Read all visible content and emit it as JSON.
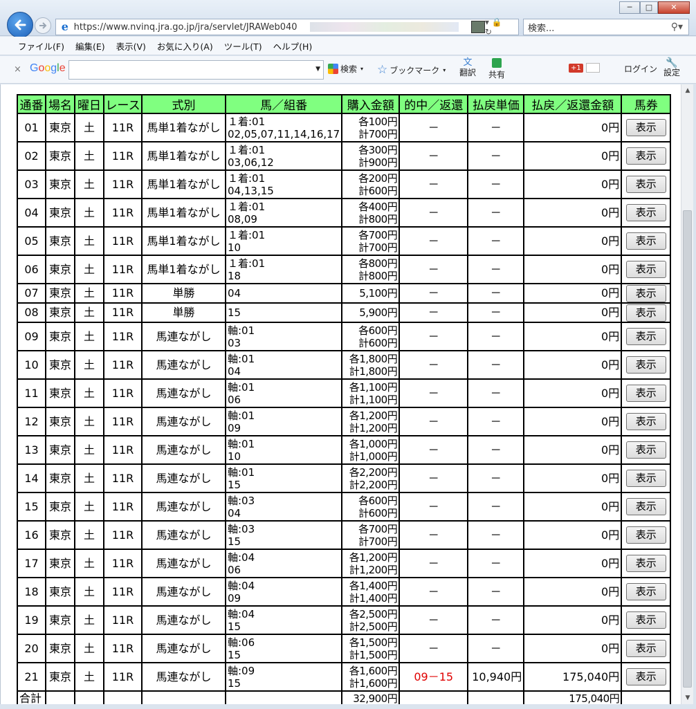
{
  "browser": {
    "url": "https://www.nvinq.jra.go.jp/jra/servlet/JRAWeb040",
    "search_placeholder": "検索...",
    "window_buttons": {
      "minimize": "─",
      "maximize": "□",
      "close": "✕"
    }
  },
  "menu": [
    "ファイル(F)",
    "編集(E)",
    "表示(V)",
    "お気に入り(A)",
    "ツール(T)",
    "ヘルプ(H)"
  ],
  "google_toolbar": {
    "close": "×",
    "logo": "Google",
    "search_label": "検索",
    "bookmark_label": "ブックマーク",
    "translate_label": "翻訳",
    "share_label": "共有",
    "plus_label": "+1",
    "login_label": "ログイン",
    "settings_label": "設定"
  },
  "colors": {
    "header_bg": "#80ff80",
    "hit_text": "#e00000",
    "brand_g_blue": "#4285f4"
  },
  "table": {
    "headers": [
      "通番",
      "場名",
      "曜日",
      "レース",
      "式別",
      "馬／組番",
      "購入金額",
      "的中／返還",
      "払戻単価",
      "払戻／返還金額",
      "馬券"
    ],
    "rows": [
      {
        "no": "01",
        "place": "東京",
        "day": "土",
        "race": "11R",
        "type": "馬単1着ながし",
        "combo1": "１着:01",
        "combo2": "02,05,07,11,14,16,17",
        "amt1": "各100円",
        "amt2": "計700円",
        "hit": "－",
        "unit": "－",
        "payout": "0円",
        "btn": "表示"
      },
      {
        "no": "02",
        "place": "東京",
        "day": "土",
        "race": "11R",
        "type": "馬単1着ながし",
        "combo1": "１着:01",
        "combo2": "03,06,12",
        "amt1": "各300円",
        "amt2": "計900円",
        "hit": "－",
        "unit": "－",
        "payout": "0円",
        "btn": "表示"
      },
      {
        "no": "03",
        "place": "東京",
        "day": "土",
        "race": "11R",
        "type": "馬単1着ながし",
        "combo1": "１着:01",
        "combo2": "04,13,15",
        "amt1": "各200円",
        "amt2": "計600円",
        "hit": "－",
        "unit": "－",
        "payout": "0円",
        "btn": "表示"
      },
      {
        "no": "04",
        "place": "東京",
        "day": "土",
        "race": "11R",
        "type": "馬単1着ながし",
        "combo1": "１着:01",
        "combo2": "08,09",
        "amt1": "各400円",
        "amt2": "計800円",
        "hit": "－",
        "unit": "－",
        "payout": "0円",
        "btn": "表示"
      },
      {
        "no": "05",
        "place": "東京",
        "day": "土",
        "race": "11R",
        "type": "馬単1着ながし",
        "combo1": "１着:01",
        "combo2": "10",
        "amt1": "各700円",
        "amt2": "計700円",
        "hit": "－",
        "unit": "－",
        "payout": "0円",
        "btn": "表示"
      },
      {
        "no": "06",
        "place": "東京",
        "day": "土",
        "race": "11R",
        "type": "馬単1着ながし",
        "combo1": "１着:01",
        "combo2": "18",
        "amt1": "各800円",
        "amt2": "計800円",
        "hit": "－",
        "unit": "－",
        "payout": "0円",
        "btn": "表示"
      },
      {
        "no": "07",
        "place": "東京",
        "day": "土",
        "race": "11R",
        "type": "単勝",
        "combo1": "04",
        "combo2": "",
        "amt1": "",
        "amt2": "5,100円",
        "hit": "－",
        "unit": "－",
        "payout": "0円",
        "btn": "表示",
        "short": true
      },
      {
        "no": "08",
        "place": "東京",
        "day": "土",
        "race": "11R",
        "type": "単勝",
        "combo1": "15",
        "combo2": "",
        "amt1": "",
        "amt2": "5,900円",
        "hit": "－",
        "unit": "－",
        "payout": "0円",
        "btn": "表示",
        "short": true
      },
      {
        "no": "09",
        "place": "東京",
        "day": "土",
        "race": "11R",
        "type": "馬連ながし",
        "combo1": "軸:01",
        "combo2": "03",
        "amt1": "各600円",
        "amt2": "計600円",
        "hit": "－",
        "unit": "－",
        "payout": "0円",
        "btn": "表示"
      },
      {
        "no": "10",
        "place": "東京",
        "day": "土",
        "race": "11R",
        "type": "馬連ながし",
        "combo1": "軸:01",
        "combo2": "04",
        "amt1": "各1,800円",
        "amt2": "計1,800円",
        "hit": "－",
        "unit": "－",
        "payout": "0円",
        "btn": "表示"
      },
      {
        "no": "11",
        "place": "東京",
        "day": "土",
        "race": "11R",
        "type": "馬連ながし",
        "combo1": "軸:01",
        "combo2": "06",
        "amt1": "各1,100円",
        "amt2": "計1,100円",
        "hit": "－",
        "unit": "－",
        "payout": "0円",
        "btn": "表示"
      },
      {
        "no": "12",
        "place": "東京",
        "day": "土",
        "race": "11R",
        "type": "馬連ながし",
        "combo1": "軸:01",
        "combo2": "09",
        "amt1": "各1,200円",
        "amt2": "計1,200円",
        "hit": "－",
        "unit": "－",
        "payout": "0円",
        "btn": "表示"
      },
      {
        "no": "13",
        "place": "東京",
        "day": "土",
        "race": "11R",
        "type": "馬連ながし",
        "combo1": "軸:01",
        "combo2": "10",
        "amt1": "各1,000円",
        "amt2": "計1,000円",
        "hit": "－",
        "unit": "－",
        "payout": "0円",
        "btn": "表示"
      },
      {
        "no": "14",
        "place": "東京",
        "day": "土",
        "race": "11R",
        "type": "馬連ながし",
        "combo1": "軸:01",
        "combo2": "15",
        "amt1": "各2,200円",
        "amt2": "計2,200円",
        "hit": "－",
        "unit": "－",
        "payout": "0円",
        "btn": "表示"
      },
      {
        "no": "15",
        "place": "東京",
        "day": "土",
        "race": "11R",
        "type": "馬連ながし",
        "combo1": "軸:03",
        "combo2": "04",
        "amt1": "各600円",
        "amt2": "計600円",
        "hit": "－",
        "unit": "－",
        "payout": "0円",
        "btn": "表示"
      },
      {
        "no": "16",
        "place": "東京",
        "day": "土",
        "race": "11R",
        "type": "馬連ながし",
        "combo1": "軸:03",
        "combo2": "15",
        "amt1": "各700円",
        "amt2": "計700円",
        "hit": "－",
        "unit": "－",
        "payout": "0円",
        "btn": "表示"
      },
      {
        "no": "17",
        "place": "東京",
        "day": "土",
        "race": "11R",
        "type": "馬連ながし",
        "combo1": "軸:04",
        "combo2": "06",
        "amt1": "各1,200円",
        "amt2": "計1,200円",
        "hit": "－",
        "unit": "－",
        "payout": "0円",
        "btn": "表示"
      },
      {
        "no": "18",
        "place": "東京",
        "day": "土",
        "race": "11R",
        "type": "馬連ながし",
        "combo1": "軸:04",
        "combo2": "09",
        "amt1": "各1,400円",
        "amt2": "計1,400円",
        "hit": "－",
        "unit": "－",
        "payout": "0円",
        "btn": "表示"
      },
      {
        "no": "19",
        "place": "東京",
        "day": "土",
        "race": "11R",
        "type": "馬連ながし",
        "combo1": "軸:04",
        "combo2": "15",
        "amt1": "各2,500円",
        "amt2": "計2,500円",
        "hit": "－",
        "unit": "－",
        "payout": "0円",
        "btn": "表示"
      },
      {
        "no": "20",
        "place": "東京",
        "day": "土",
        "race": "11R",
        "type": "馬連ながし",
        "combo1": "軸:06",
        "combo2": "15",
        "amt1": "各1,500円",
        "amt2": "計1,500円",
        "hit": "－",
        "unit": "－",
        "payout": "0円",
        "btn": "表示"
      },
      {
        "no": "21",
        "place": "東京",
        "day": "土",
        "race": "11R",
        "type": "馬連ながし",
        "combo1": "軸:09",
        "combo2": "15",
        "amt1": "各1,600円",
        "amt2": "計1,600円",
        "hit": "09－15",
        "unit": "10,940円",
        "payout": "175,040円",
        "btn": "表示",
        "winner": true
      }
    ],
    "total": {
      "label": "合計",
      "purchase": "32,900円",
      "payout": "175,040円"
    }
  }
}
